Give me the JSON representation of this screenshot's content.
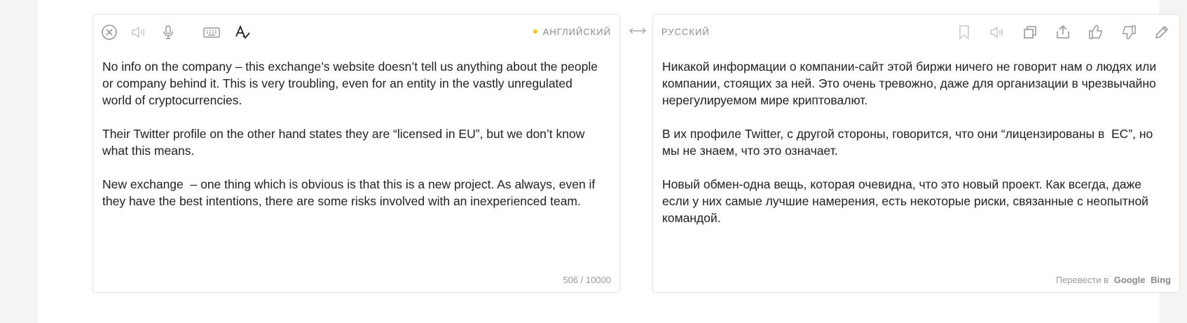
{
  "source": {
    "language": "АНГЛИЙСКИЙ",
    "paragraphs": [
      "No info on the company – this exchange’s website doesn’t tell us anything about the people or company behind it. This is very troubling, even for an entity in the vastly unregulated world of cryptocurrencies.",
      "Their Twitter profile on the other hand states they are “licensed in EU”, but we don’t know what this means.",
      "New exchange  – one thing which is obvious is that this is a new project. As always, even if they have the best intentions, there are some risks involved with an inexperienced team."
    ],
    "counter": "506 / 10000",
    "toolbar_icons": [
      "clear-icon",
      "speaker-icon",
      "microphone-icon",
      "keyboard-icon",
      "spellcheck-icon"
    ]
  },
  "target": {
    "language": "РУССКИЙ",
    "paragraphs": [
      "Никакой информации о компании-сайт этой биржи ничего не говорит нам о людях или компании, стоящих за ней. Это очень тревожно, даже для организации в чрезвычайно нерегулируемом мире криптовалют.",
      "В их профиле Twitter, с другой стороны, говорится, что они “лицензированы в  ЕС”, но мы не знаем, что это означает.",
      "Новый обмен-одна вещь, которая очевидна, что это новый проект. Как всегда, даже если у них самые лучшие намерения, есть некоторые риски, связанные с неопытной командой."
    ],
    "translate_in_label": "Перевести в",
    "engines": [
      "Google",
      "Bing"
    ],
    "toolbar_icons": [
      "bookmark-icon",
      "speaker-icon",
      "copy-icon",
      "share-icon",
      "thumbs-up-icon",
      "thumbs-down-icon",
      "edit-icon"
    ]
  },
  "colors": {
    "accent_dot": "#f5c518",
    "icon_gray": "#9a9a9a",
    "text": "#222222"
  }
}
